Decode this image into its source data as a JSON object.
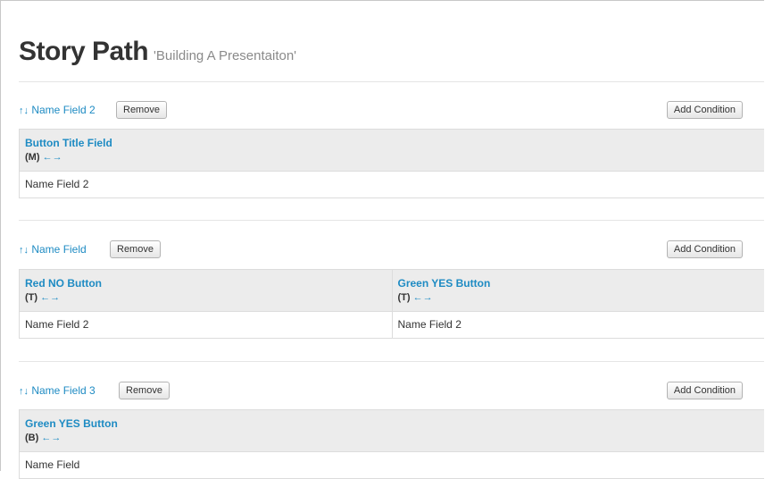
{
  "page": {
    "title": "Story Path",
    "subtitle": "'Building A Presentaiton'"
  },
  "icons": {
    "up": "↑",
    "down": "↓",
    "left": "←",
    "right": "→"
  },
  "colors": {
    "link": "#1e8bc3",
    "header_bg": "#ececec",
    "border": "#dcdcdc"
  },
  "paths": [
    {
      "name": "Name Field 2",
      "remove_label": "Remove",
      "add_label": "Add Condition",
      "columns": [
        {
          "title": "Button Title Field",
          "tag": "(M)",
          "value": "Name Field 2"
        }
      ]
    },
    {
      "name": "Name Field",
      "remove_label": "Remove",
      "add_label": "Add Condition",
      "columns": [
        {
          "title": "Red NO Button",
          "tag": "(T)",
          "value": "Name Field 2"
        },
        {
          "title": "Green YES Button",
          "tag": "(T)",
          "value": "Name Field 2"
        }
      ]
    },
    {
      "name": "Name Field 3",
      "remove_label": "Remove",
      "add_label": "Add Condition",
      "columns": [
        {
          "title": "Green YES Button",
          "tag": "(B)",
          "value": "Name Field"
        }
      ]
    }
  ]
}
